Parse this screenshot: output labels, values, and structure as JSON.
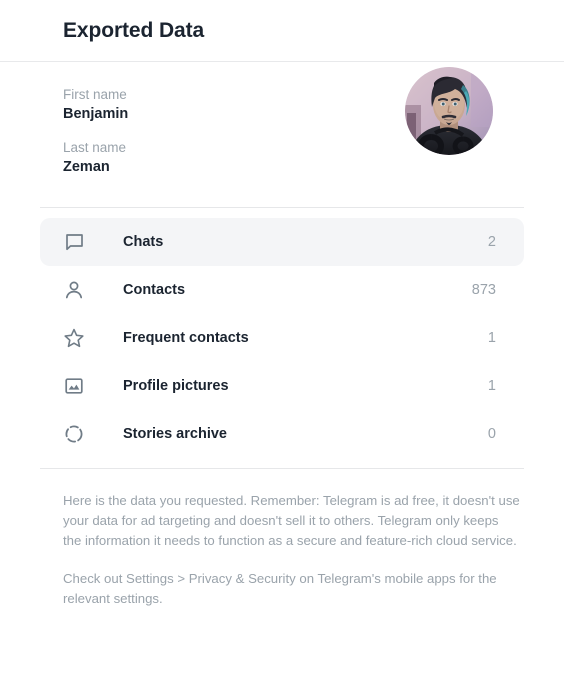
{
  "header": {
    "title": "Exported Data"
  },
  "profile": {
    "fields": [
      {
        "label": "First name",
        "value": "Benjamin"
      },
      {
        "label": "Last name",
        "value": "Zeman"
      }
    ],
    "avatar": {
      "name": "profile-photo",
      "alt": "Profile picture of Benjamin Zeman",
      "background_color": "#cdb8c9",
      "hair_color": "#2b2a33",
      "accent_color": "#4aa8b5",
      "skin_color": "#c9a893",
      "shirt_color": "#23242b"
    }
  },
  "stats": {
    "items": [
      {
        "icon": "chat-bubble-icon",
        "label": "Chats",
        "count": "2",
        "selected": true
      },
      {
        "icon": "person-icon",
        "label": "Contacts",
        "count": "873",
        "selected": false
      },
      {
        "icon": "star-icon",
        "label": "Frequent contacts",
        "count": "1",
        "selected": false
      },
      {
        "icon": "image-icon",
        "label": "Profile pictures",
        "count": "1",
        "selected": false
      },
      {
        "icon": "stories-circle-icon",
        "label": "Stories archive",
        "count": "0",
        "selected": false
      }
    ]
  },
  "notes": [
    "Here is the data you requested. Remember: Telegram is ad free, it doesn't use your data for ad targeting and doesn't sell it to others. Telegram only keeps the information it needs to function as a secure and feature-rich cloud service.",
    "Check out Settings > Privacy & Security on Telegram's mobile apps for the relevant settings."
  ],
  "colors": {
    "text_primary": "#1b2430",
    "text_muted": "#9aa3ab",
    "icon": "#707c87",
    "row_highlight": "#f4f5f7",
    "divider": "#e6e7e9"
  }
}
